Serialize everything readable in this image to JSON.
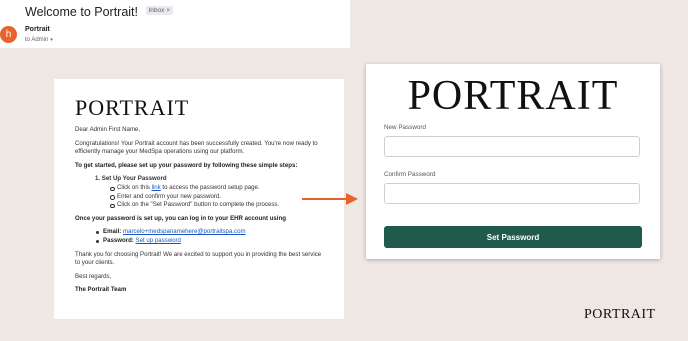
{
  "email": {
    "subject": "Welcome to Portrait!",
    "label": "Inbox",
    "label_close": "×",
    "avatar_letter": "h",
    "sender": "Portrait",
    "recipient": "to Admin",
    "recipient_caret": "▾"
  },
  "body": {
    "logo": "PORTRAIT",
    "greeting": "Dear Admin First Name,",
    "intro": "Congratulations! Your Portrait account has been successfully created. You're now ready to efficiently manage your MedSpa operations using our platform.",
    "get_started": "To get started, please set up your password by following these simple steps:",
    "step1_title": "1. Set Up Your Password",
    "step_a_pre": "Click on this",
    "step_a_link": "link",
    "step_a_post": "to access the password setup page.",
    "step_b": "Enter and confirm your new password.",
    "step_c": "Click on the \"Set Password\" button to complete the process.",
    "login_heading": "Once your password is set up, you can log in to your EHR account using",
    "email_label": "Email:",
    "email_value": "marcelo+medspanamehere@portraitspa.com",
    "password_label": "Password:",
    "password_value": "Set up password",
    "thanks": "Thank you for choosing Portrait! We are excited to support you in providing the best service to your clients.",
    "regards": "Best regards,",
    "team": "The Portrait Team"
  },
  "panel": {
    "logo": "PORTRAIT",
    "new_password_label": "New Password",
    "new_password_value": "",
    "confirm_password_label": "Confirm Password",
    "confirm_password_value": "",
    "submit_label": "Set Password",
    "button_color": "#1f5a4b"
  },
  "footer_logo": "PORTRAIT",
  "arrow_color": "#e8622b"
}
